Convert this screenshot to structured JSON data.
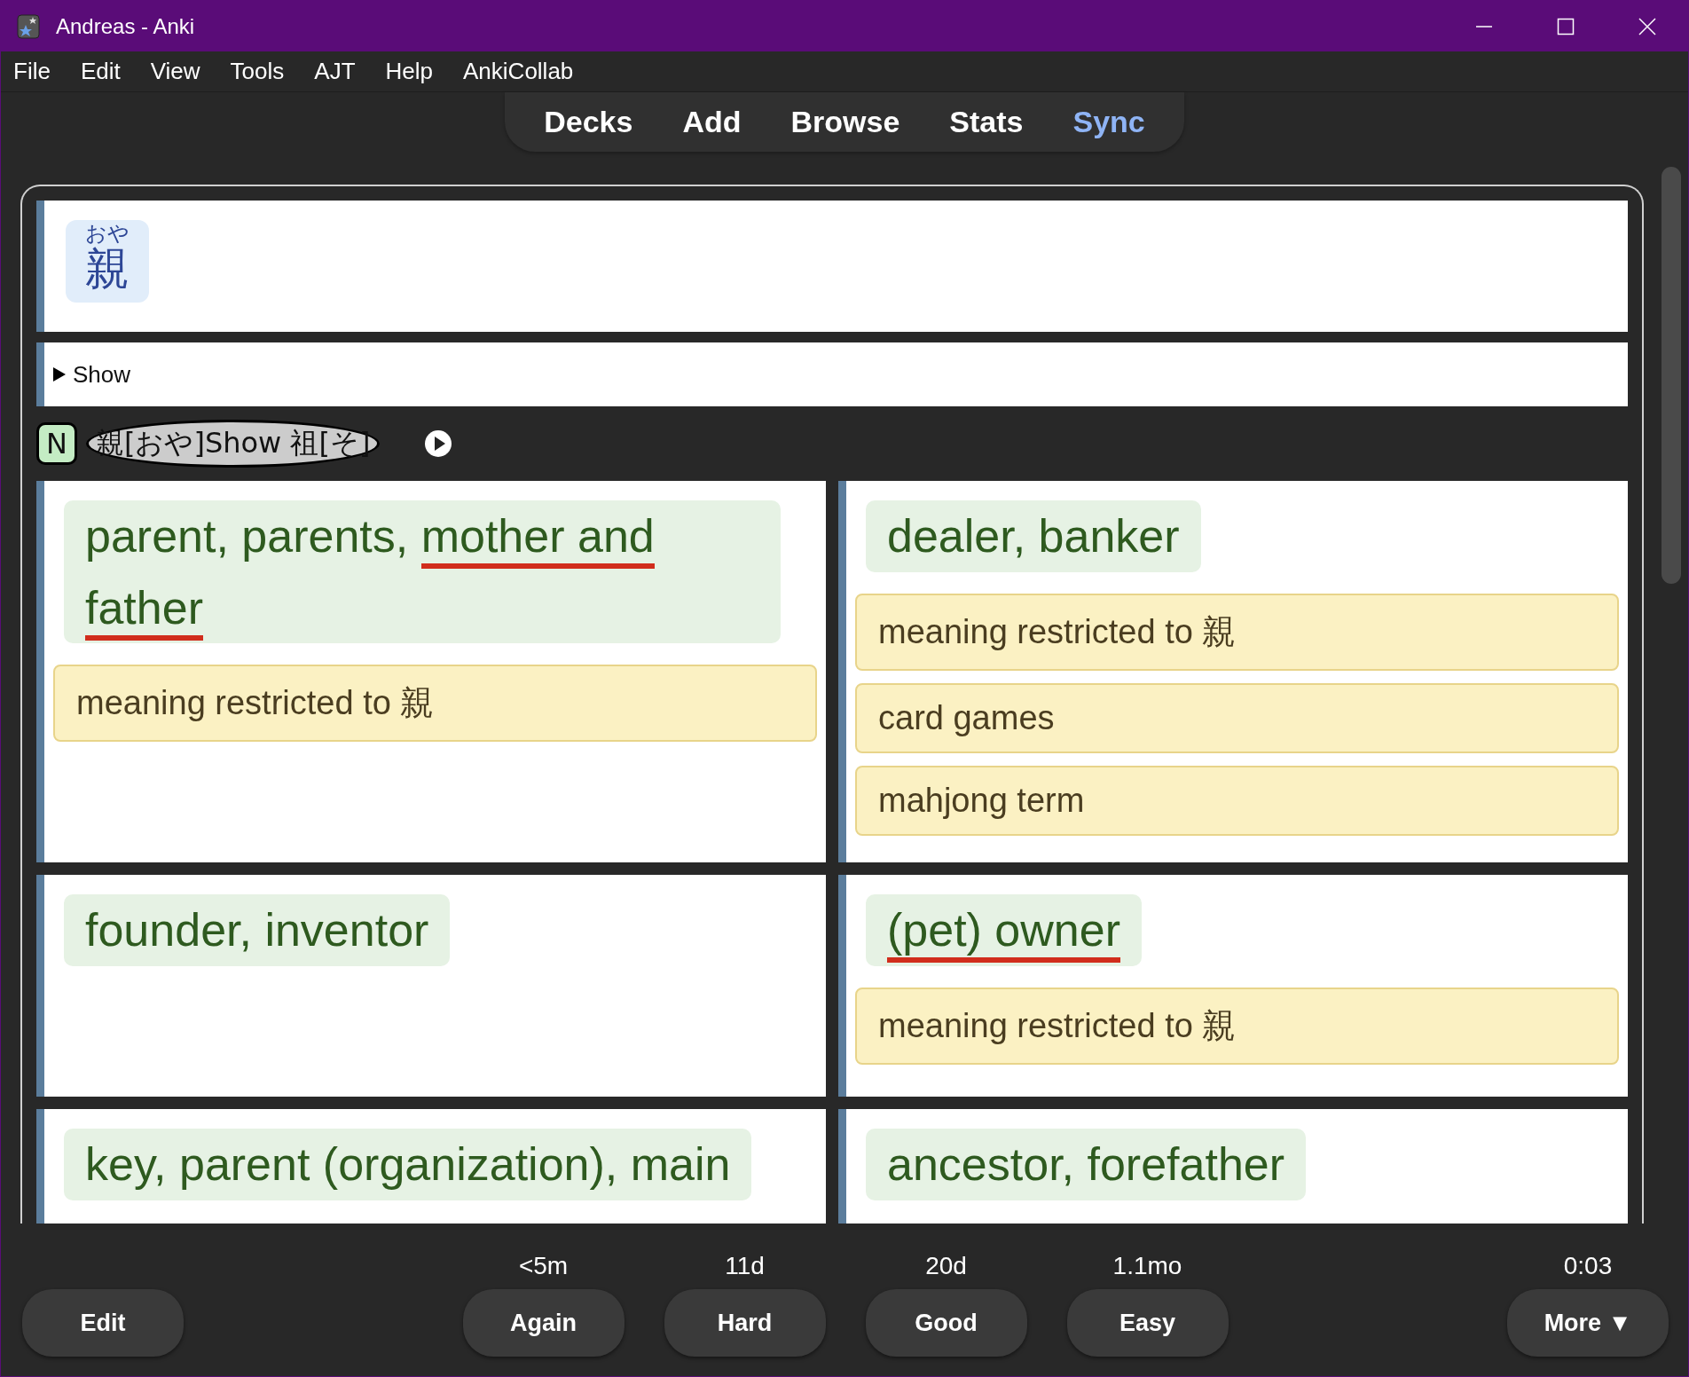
{
  "window": {
    "title": "Andreas - Anki"
  },
  "menu": [
    {
      "label": "File"
    },
    {
      "label": "Edit"
    },
    {
      "label": "View"
    },
    {
      "label": "Tools"
    },
    {
      "label": "AJT"
    },
    {
      "label": "Help"
    },
    {
      "label": "AnkiCollab"
    }
  ],
  "toolbar": [
    {
      "label": "Decks",
      "highlighted": false
    },
    {
      "label": "Add",
      "highlighted": false
    },
    {
      "label": "Browse",
      "highlighted": false
    },
    {
      "label": "Stats",
      "highlighted": false
    },
    {
      "label": "Sync",
      "highlighted": true
    }
  ],
  "card": {
    "reading": "おや",
    "word": "親",
    "toggle": "Show",
    "tags": [
      {
        "kind": "level",
        "label": "N"
      },
      {
        "kind": "furigana",
        "label": "親[おや]Show 祖[そ]"
      }
    ],
    "senses": [
      {
        "gloss": [
          {
            "text": "parent, parents, ",
            "marked": false
          },
          {
            "text": "mother and father",
            "marked": true
          }
        ],
        "notes": [
          "meaning restricted to 親"
        ]
      },
      {
        "gloss": [
          {
            "text": "dealer, banker",
            "marked": false
          }
        ],
        "notes": [
          "meaning restricted to 親",
          "card games",
          "mahjong term"
        ]
      },
      {
        "gloss": [
          {
            "text": "founder, inventor",
            "marked": false
          }
        ]
      },
      {
        "gloss": [
          {
            "text": "(pet) owner",
            "marked": true
          }
        ],
        "notes": [
          "meaning restricted to 親"
        ]
      },
      {
        "gloss": [
          {
            "text": "key, parent (organization), main",
            "marked": false
          }
        ]
      },
      {
        "gloss": [
          {
            "text": "ancestor, forefather",
            "marked": false
          }
        ]
      }
    ]
  },
  "answer_buttons": [
    {
      "label": "Again",
      "interval": "<5m"
    },
    {
      "label": "Hard",
      "interval": "11d"
    },
    {
      "label": "Good",
      "interval": "20d"
    },
    {
      "label": "Easy",
      "interval": "1.1mo"
    }
  ],
  "edit_button": "Edit",
  "more_button": "More ▼",
  "timer": "0:03"
}
